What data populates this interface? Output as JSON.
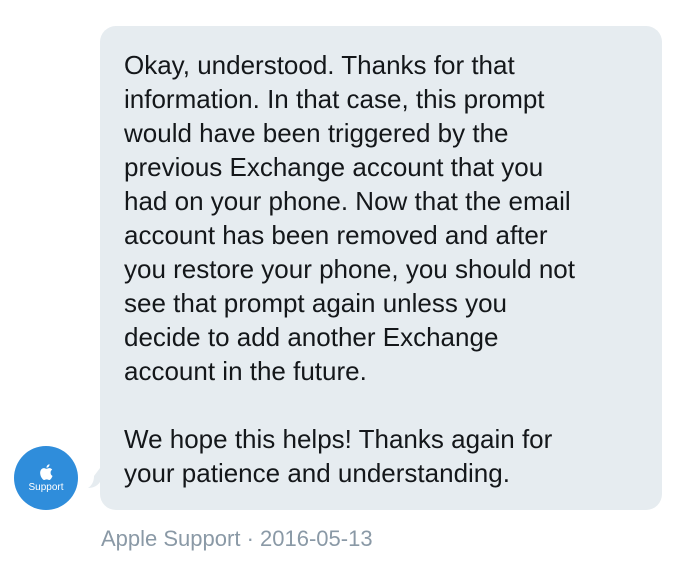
{
  "message": {
    "paragraphs": [
      "Okay, understood. Thanks for that\ninformation. In that case, this prompt\nwould have been triggered by the\nprevious Exchange account that you\nhad on your phone. Now that the email\naccount has been removed and after\nyou restore your phone, you should not\nsee that prompt again unless you\ndecide to add another Exchange\naccount in the future.",
      "We hope this helps! Thanks again for\nyour patience and understanding."
    ],
    "bubble_color": "#e6ecf0",
    "text_color": "#14171a"
  },
  "sender": {
    "avatar_label": "Support",
    "avatar_icon": "apple-logo-icon",
    "avatar_color": "#2f8ddb",
    "name": "Apple Support",
    "separator": "·",
    "date": "2016-05-13"
  }
}
